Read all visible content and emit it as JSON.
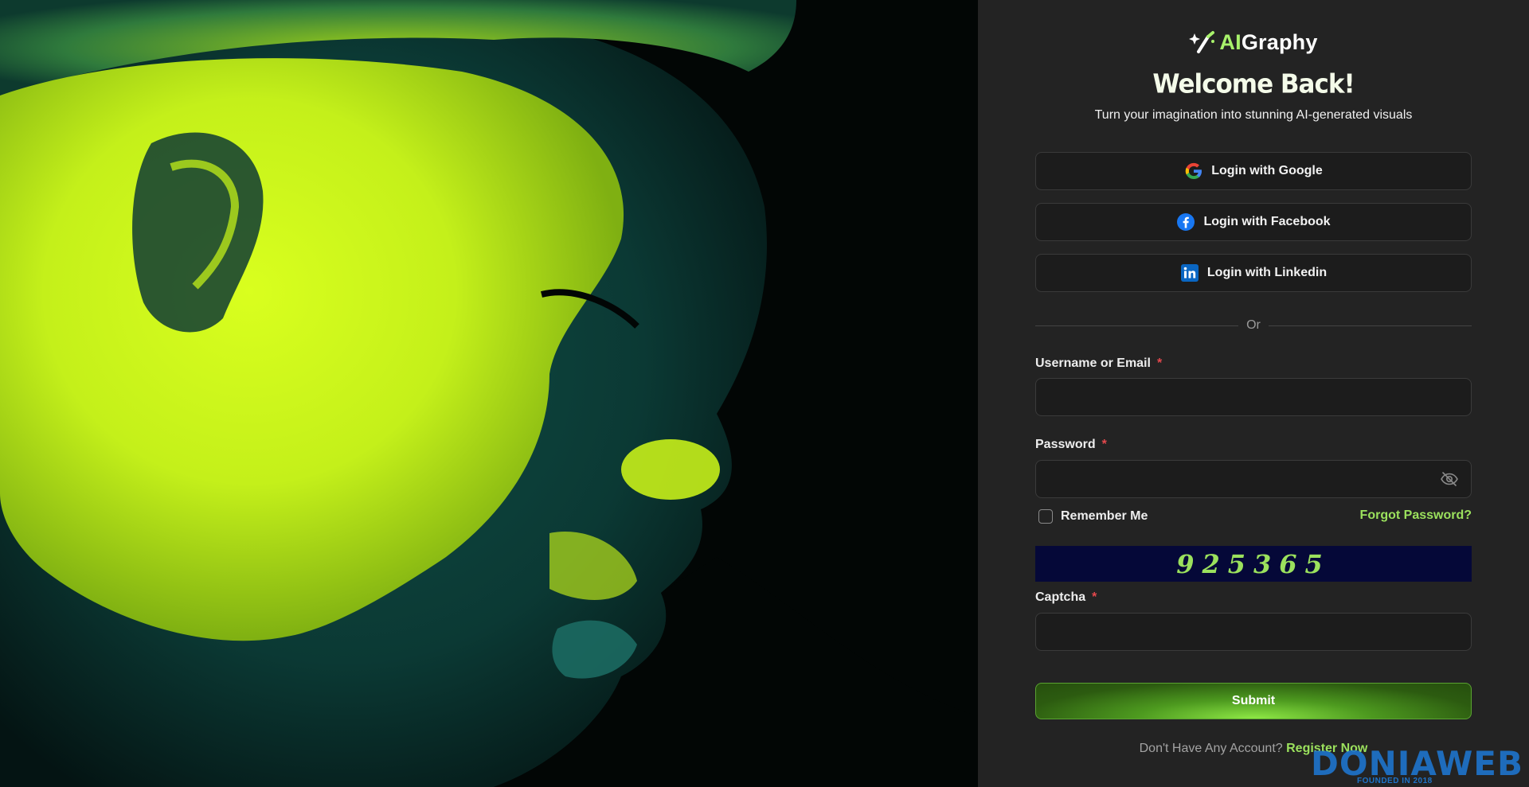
{
  "brand": {
    "logo_ai": "AI",
    "logo_rest": "Graphy",
    "accent_color": "#9be15d"
  },
  "header": {
    "title": "Welcome Back!",
    "subtitle": "Turn your imagination into stunning AI-generated visuals"
  },
  "social": [
    {
      "label": "Login with Google",
      "icon": "google-icon"
    },
    {
      "label": "Login with Facebook",
      "icon": "facebook-icon"
    },
    {
      "label": "Login with Linkedin",
      "icon": "linkedin-icon"
    }
  ],
  "divider": {
    "label": "Or"
  },
  "form": {
    "username": {
      "label": "Username or Email",
      "required": "*",
      "value": "",
      "placeholder": ""
    },
    "password": {
      "label": "Password",
      "required": "*",
      "value": "",
      "placeholder": "",
      "toggle_icon": "eye-off-icon"
    },
    "remember": {
      "label": "Remember Me",
      "checked": false
    },
    "forgot": {
      "label": "Forgot Password?"
    },
    "captcha_image": {
      "digits": "925365"
    },
    "captcha": {
      "label": "Captcha",
      "required": "*",
      "value": "",
      "placeholder": ""
    },
    "submit": {
      "label": "Submit"
    }
  },
  "footer": {
    "prompt": "Don't Have Any Account?",
    "link": "Register Now"
  },
  "watermark": {
    "text": "DONIAWEB",
    "sub": "FOUNDED IN 2018"
  }
}
